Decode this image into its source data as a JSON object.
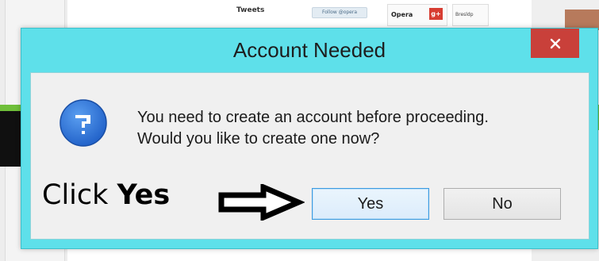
{
  "background": {
    "tweets_label": "Tweets",
    "follow_button_label": "Follow @opera",
    "opera_label": "Opera",
    "gplus_label": "g+",
    "small_label": "Bresldp"
  },
  "dialog": {
    "title": "Account Needed",
    "close_label": "✕",
    "message_line1": "You need to create an account before proceeding.",
    "message_line2": "Would you like to create one now?",
    "yes_label": "Yes",
    "no_label": "No"
  },
  "annotation": {
    "click_text": "Click",
    "yes_text": "Yes"
  },
  "icons": {
    "question": "question-icon",
    "arrow": "right-arrow-icon",
    "close": "close-icon"
  },
  "colors": {
    "dialog_frame": "#5ee0ea",
    "close_button": "#c9403a",
    "question_icon": "#2d6fd3",
    "client_area": "#f0f0f0",
    "default_button_border": "#3c9be1"
  }
}
